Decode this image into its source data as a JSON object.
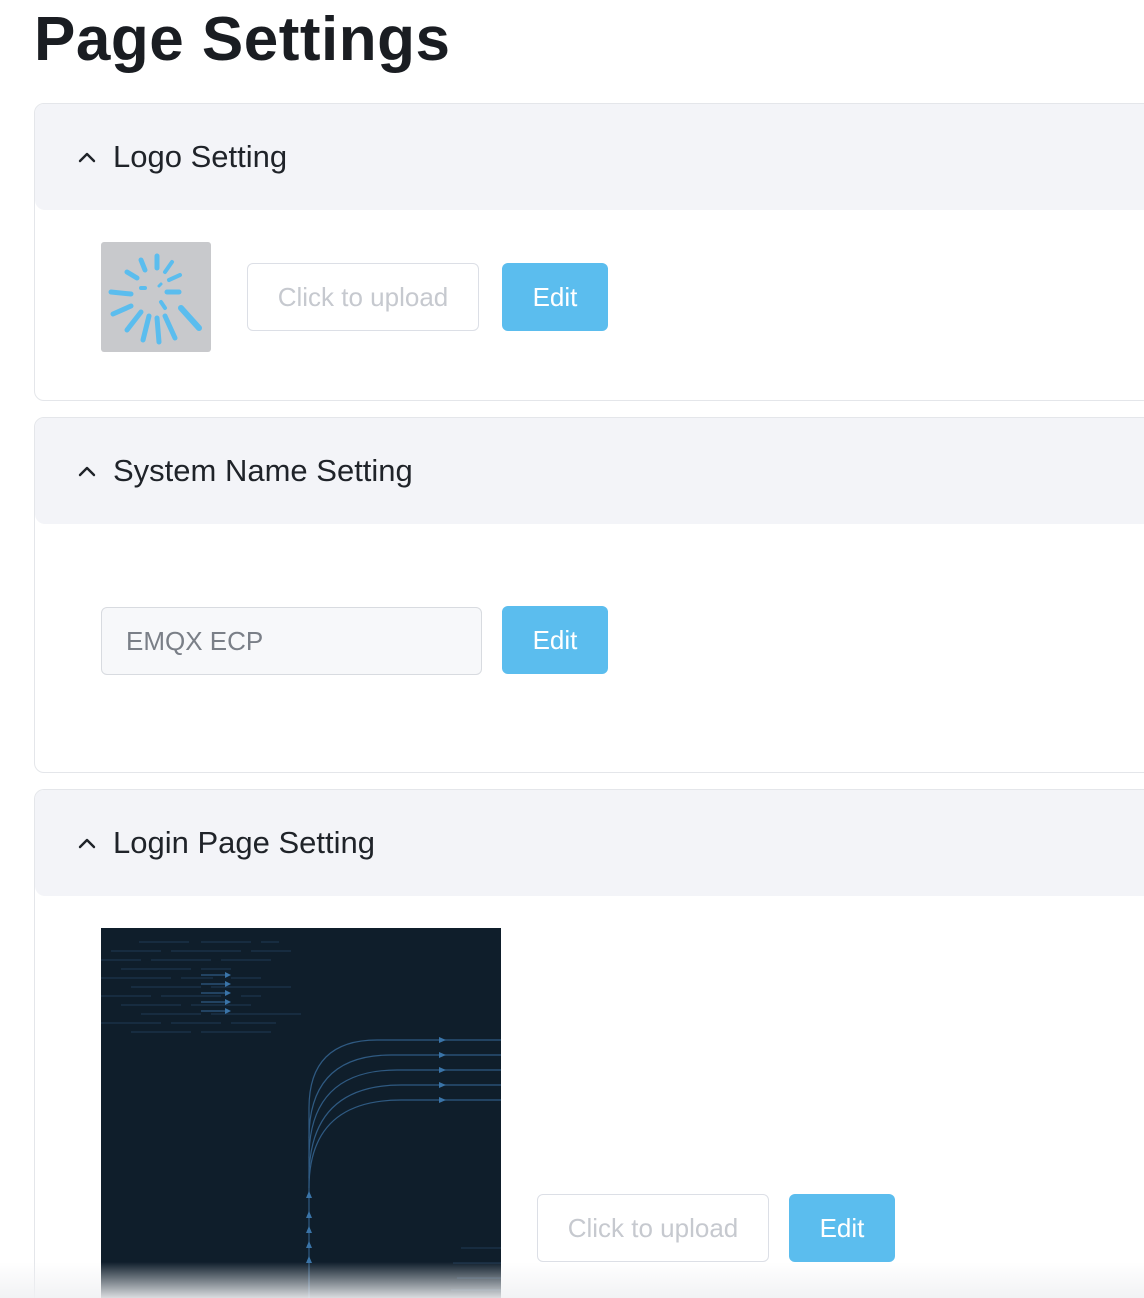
{
  "page": {
    "title": "Page Settings"
  },
  "sections": {
    "logo": {
      "title": "Logo Setting",
      "upload_label": "Click to upload",
      "edit_label": "Edit"
    },
    "system_name": {
      "title": "System Name Setting",
      "input_value": "EMQX ECP",
      "edit_label": "Edit"
    },
    "login_page": {
      "title": "Login Page Setting",
      "upload_label": "Click to upload",
      "edit_label": "Edit"
    }
  },
  "colors": {
    "accent": "#5bbdee",
    "header_bg": "#f3f4f8",
    "preview_bg": "#0f1e2b"
  },
  "icons": {
    "section_toggle": "chevron-up-icon"
  }
}
